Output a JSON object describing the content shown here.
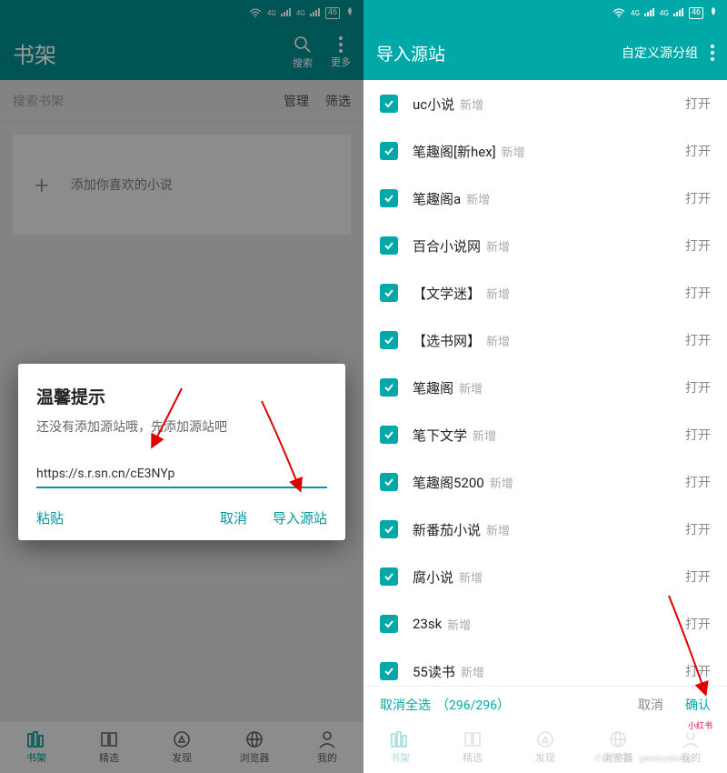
{
  "status": {
    "battery": "46"
  },
  "left": {
    "header_title": "书架",
    "search_label": "搜索",
    "more_label": "更多",
    "search_placeholder": "搜索书架",
    "manage": "管理",
    "filter": "筛选",
    "add_hint": "添加你喜欢的小说",
    "nav": {
      "shelf": "书架",
      "featured": "精选",
      "discover": "发现",
      "browser": "浏览器",
      "mine": "我的"
    }
  },
  "dialog": {
    "title": "温馨提示",
    "message": "还没有添加源站哦，先添加源站吧",
    "input_value": "https://s.r.sn.cn/cE3NYp",
    "paste": "粘贴",
    "cancel": "取消",
    "import": "导入源站"
  },
  "right": {
    "header_title": "导入源站",
    "group_label": "自定义源分组",
    "new_tag": "新增",
    "open_label": "打开",
    "sources": [
      "uc小说",
      "笔趣阁[新hex]",
      "笔趣阁a",
      "百合小说网",
      "【文学迷】",
      "【选书网】",
      "笔趣阁",
      "笔下文学",
      "笔趣阁5200",
      "新番茄小说",
      "腐小说",
      "23sk",
      "55读书"
    ],
    "toolbar": {
      "deselect_all": "取消全选",
      "count": "（296/296）",
      "cancel": "取消",
      "confirm": "确认"
    }
  },
  "watermark": {
    "logo": "小红书",
    "id": "小红书号：gansuyalong"
  }
}
